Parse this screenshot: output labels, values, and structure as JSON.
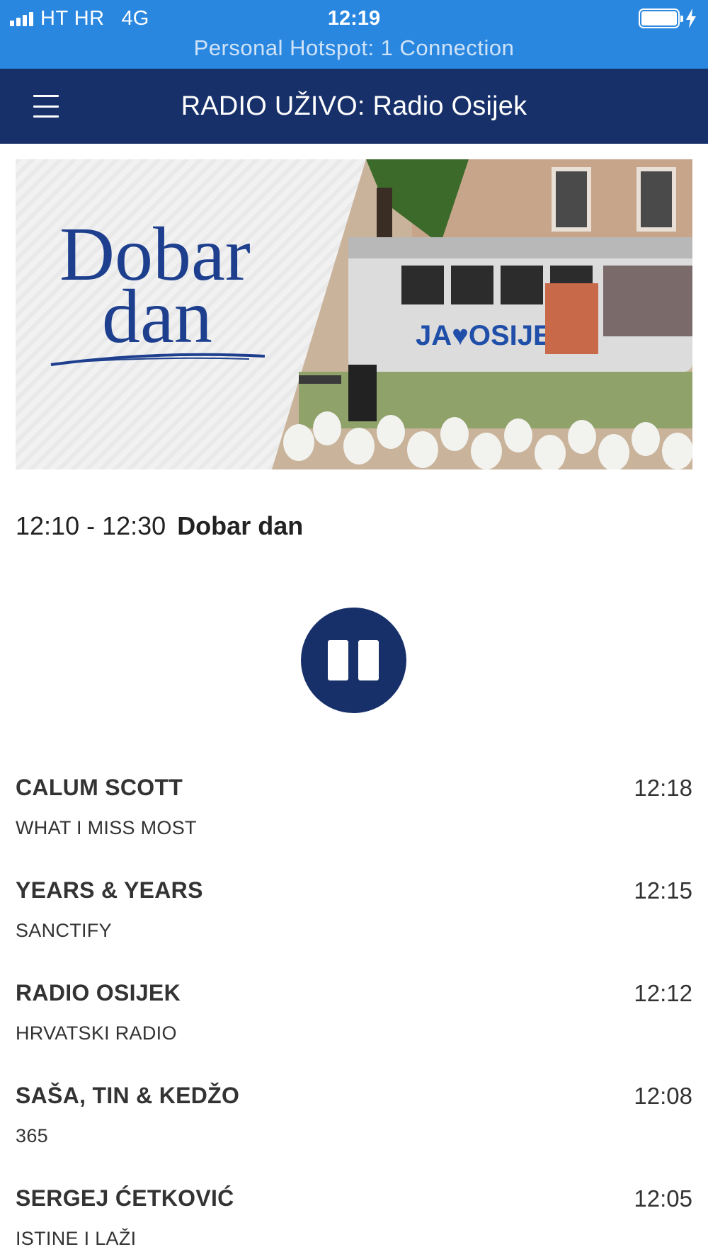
{
  "status_bar": {
    "carrier": "HT HR",
    "network": "4G",
    "time": "12:19",
    "hotspot": "Personal Hotspot: 1 Connection",
    "background_color": "#2a87e0"
  },
  "header": {
    "title": "RADIO UŽIVO: Radio Osijek",
    "menu_icon": "hamburger-menu-icon",
    "background_color": "#17306a"
  },
  "banner": {
    "logo_line1": "Dobar",
    "logo_line2": "dan",
    "tram_text": "JA♥OSIJEK"
  },
  "now_playing": {
    "time_range": "12:10 - 12:30",
    "show_name": "Dobar dan",
    "control_icon": "pause-icon"
  },
  "tracks": [
    {
      "artist": "CALUM SCOTT",
      "title": "WHAT I MISS MOST",
      "time": "12:18"
    },
    {
      "artist": "YEARS & YEARS",
      "title": "SANCTIFY",
      "time": "12:15"
    },
    {
      "artist": "RADIO OSIJEK",
      "title": "HRVATSKI RADIO",
      "time": "12:12"
    },
    {
      "artist": "SAŠA, TIN & KEDŽO",
      "title": "365",
      "time": "12:08"
    },
    {
      "artist": "SERGEJ ĆETKOVIĆ",
      "title": "ISTINE I LAŽI",
      "time": "12:05"
    }
  ]
}
